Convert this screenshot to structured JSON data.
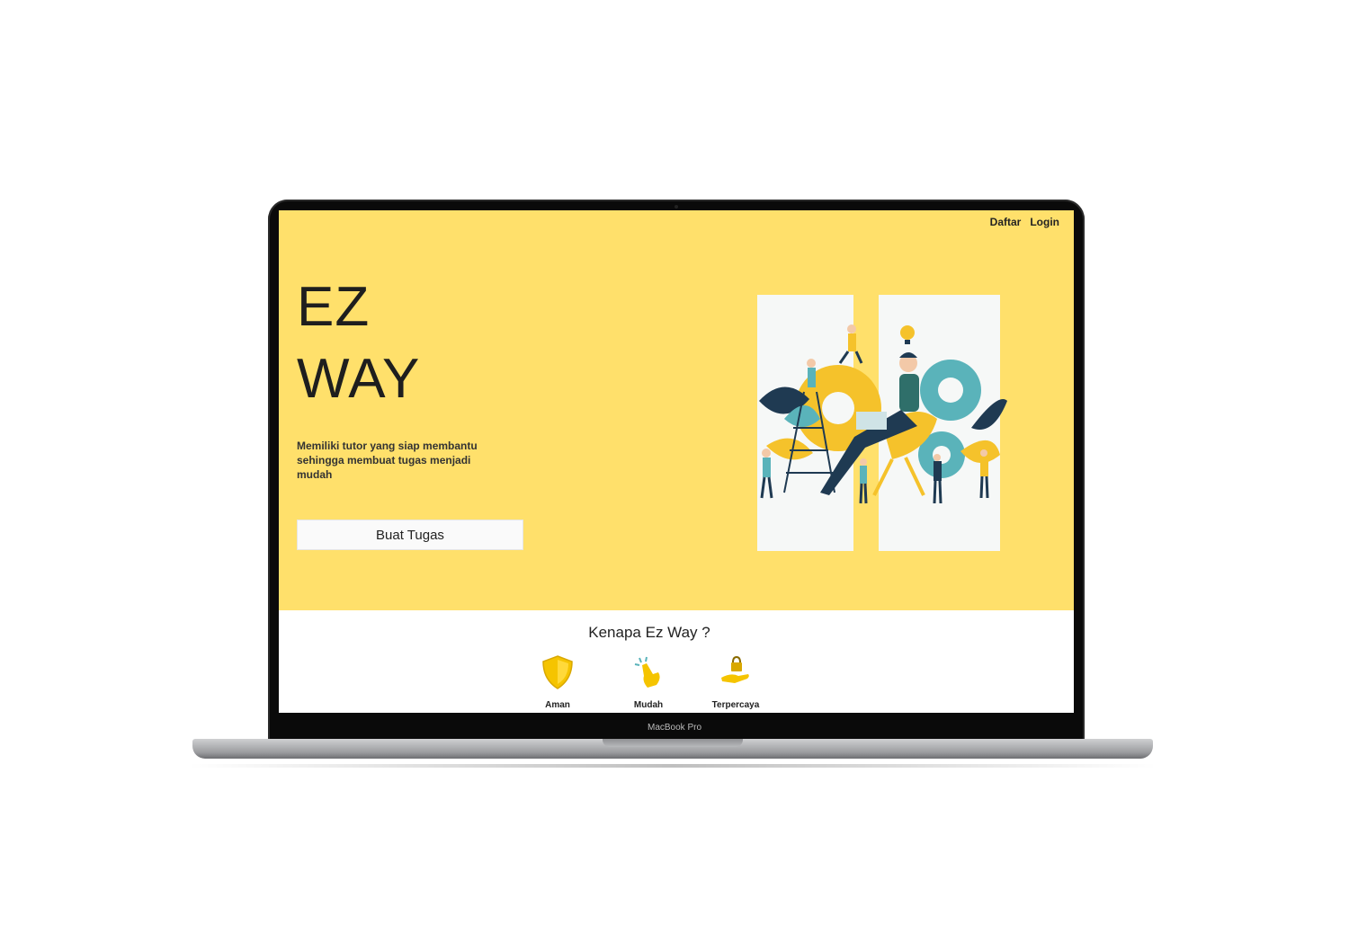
{
  "nav": {
    "items": [
      "Daftar",
      "Login"
    ]
  },
  "hero": {
    "brand_line1": "EZ",
    "brand_line2": "WAY",
    "tagline": "Memiliki tutor yang siap membantu sehingga membuat tugas menjadi mudah",
    "cta_label": "Buat Tugas",
    "background_color": "#ffe06b"
  },
  "why": {
    "title": "Kenapa Ez Way ?",
    "features": [
      {
        "label": "Aman",
        "icon": "shield-icon"
      },
      {
        "label": "Mudah",
        "icon": "tap-hand-icon"
      },
      {
        "label": "Terpercaya",
        "icon": "hand-lock-icon"
      }
    ]
  },
  "device": {
    "model_label": "MacBook Pro"
  }
}
